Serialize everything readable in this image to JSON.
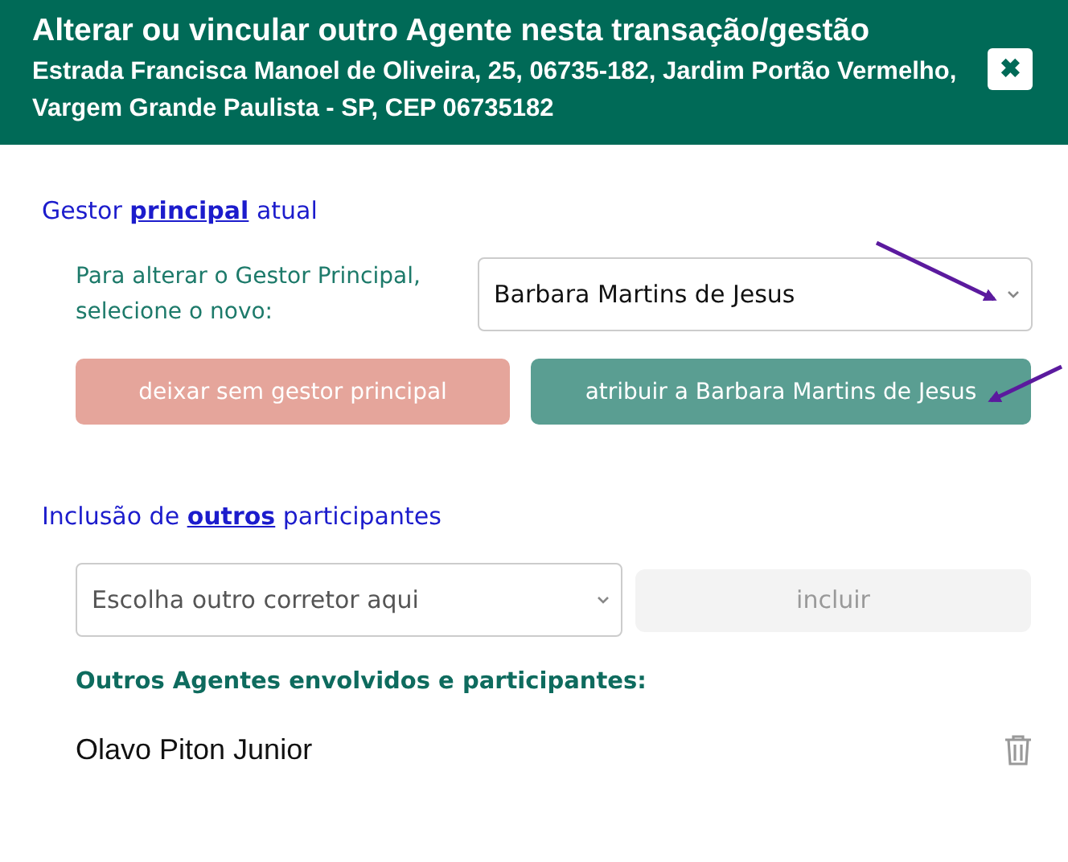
{
  "header": {
    "title": "Alterar ou vincular outro Agente nesta transação/gestão",
    "subtitle": "Estrada Francisca Manoel de Oliveira, 25, 06735-182, Jardim Portão Vermelho, Vargem Grande Paulista - SP, CEP 06735182",
    "close_label": "✖"
  },
  "main_manager": {
    "heading": {
      "before": "Gestor ",
      "link": "principal",
      "after": " atual"
    },
    "select_label": "Para alterar o Gestor Principal, selecione o novo:",
    "select_value": "Barbara Martins de Jesus",
    "buttons": [
      {
        "label": "deixar sem gestor principal",
        "kind": "danger"
      },
      {
        "label": "atribuir a Barbara Martins de Jesus",
        "kind": "confirm"
      }
    ]
  },
  "others": {
    "heading": {
      "before": "Inclusão de ",
      "link": "outros",
      "after": " participantes"
    },
    "select_placeholder": "Escolha outro corretor aqui",
    "add_button": {
      "label": "incluir",
      "disabled": true
    },
    "list_title": "Outros Agentes envolvidos e participantes:",
    "participants": [
      {
        "name": "Olavo Piton Junior"
      }
    ]
  }
}
